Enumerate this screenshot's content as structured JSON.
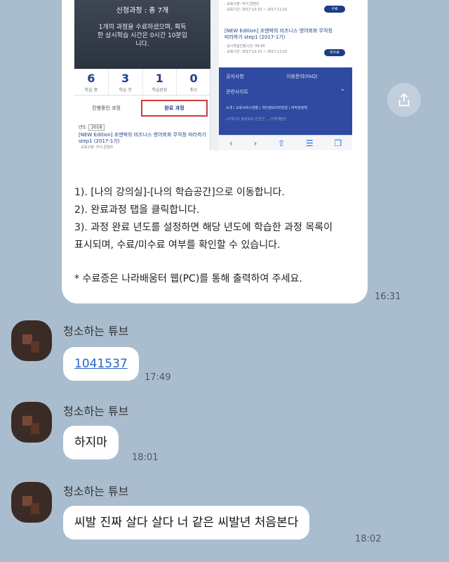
{
  "shared_card": {
    "left_panel": {
      "title": "신청과정 : 총 7개",
      "message_line1": "1개의 과정을 수료하셨으며, 획득",
      "message_line2": "한 상시학습 시간은 0시간 10분입",
      "message_line3": "니다.",
      "stats": [
        {
          "value": "6",
          "label": "학습 중"
        },
        {
          "value": "3",
          "label": "학습 전"
        },
        {
          "value": "1",
          "label": "학습완료"
        },
        {
          "value": "0",
          "label": "취소"
        }
      ],
      "tab_in_progress": "진행중인 과정",
      "tab_completed": "완료 과정",
      "year_label": "년도",
      "year_value": "2018",
      "course_title": "[NEW Edition] 조앤박의 비즈니스 영어회화 무작정 따라하기 step1 (2017-1기)",
      "course_meta": "· 교육구분: 지식 콘텐츠"
    },
    "right_panel": {
      "item1_meta_1": "· 교육구분: 지식 콘텐츠",
      "item1_meta_2": "· 교육기간: 2017.10.15 ~ 2017.11.02",
      "item1_btn": "수료",
      "course_title": "[NEW Edition] 조앤박의 비즈니스 영어회화 무작정 따라하기 step1 (2017-1기)",
      "item2_meta_1": "· 상시학습인정시간: 04:30",
      "item2_meta_2": "· 교육기간: 2017.10.15 ~ 2017.11.02",
      "item2_btn": "미수료",
      "footer_notice": "공지사항",
      "footer_faq": "이용문의(FAQ)",
      "footer_related": "관련사이트",
      "footer_links": "소개 | 교육서비스현황 | 개인정보처리방침 | 저작권정책",
      "footer_small": "(27872) 충청북도 진천군 ... 인재개발원"
    },
    "instructions": [
      "1). [나의 강의실]-[나의 학습공간]으로 이동합니다.",
      "2). 완료과정 탭을 클릭합니다.",
      "3). 과정 완료 년도를 설정하면 해당 년도에 학습한 과정 목록이",
      "표시되며, 수료/미수료 여부를 확인할 수 있습니다."
    ],
    "note": "* 수료증은 나라배움터 웹(PC)를 통해 출력하여 주세요.",
    "time": "16:31"
  },
  "messages": [
    {
      "sender": "청소하는 튜브",
      "text": "1041537",
      "time": "17:49"
    },
    {
      "sender": "청소하는 튜브",
      "text": "하지마",
      "time": "18:01"
    },
    {
      "sender": "청소하는 튜브",
      "text": "씨발 진짜 살다 살다 너 같은 씨발년 처음본다",
      "time": "18:02"
    }
  ],
  "icons": {
    "share": "share-icon",
    "avatar": "avatar"
  }
}
